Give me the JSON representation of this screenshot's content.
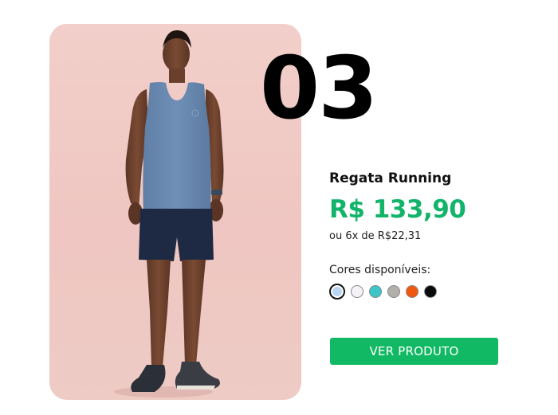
{
  "card": {
    "rank": "03",
    "product_name": "Regata Running",
    "price": "R$ 133,90",
    "installments": "ou 6x de R$22,31",
    "colors_label": "Cores disponíveis:",
    "colors": [
      {
        "name": "light-blue",
        "hex": "#b9d6f2",
        "selected": true
      },
      {
        "name": "white",
        "hex": "#f4f2f6",
        "selected": false
      },
      {
        "name": "turquoise",
        "hex": "#3cc6c8",
        "selected": false
      },
      {
        "name": "gray",
        "hex": "#b3b0ac",
        "selected": false
      },
      {
        "name": "orange",
        "hex": "#f0580f",
        "selected": false
      },
      {
        "name": "black",
        "hex": "#0a0a0a",
        "selected": false
      }
    ],
    "cta_label": "VER PRODUTO"
  },
  "theme": {
    "accent": "#12b964",
    "image_background": "#efc8c3"
  }
}
